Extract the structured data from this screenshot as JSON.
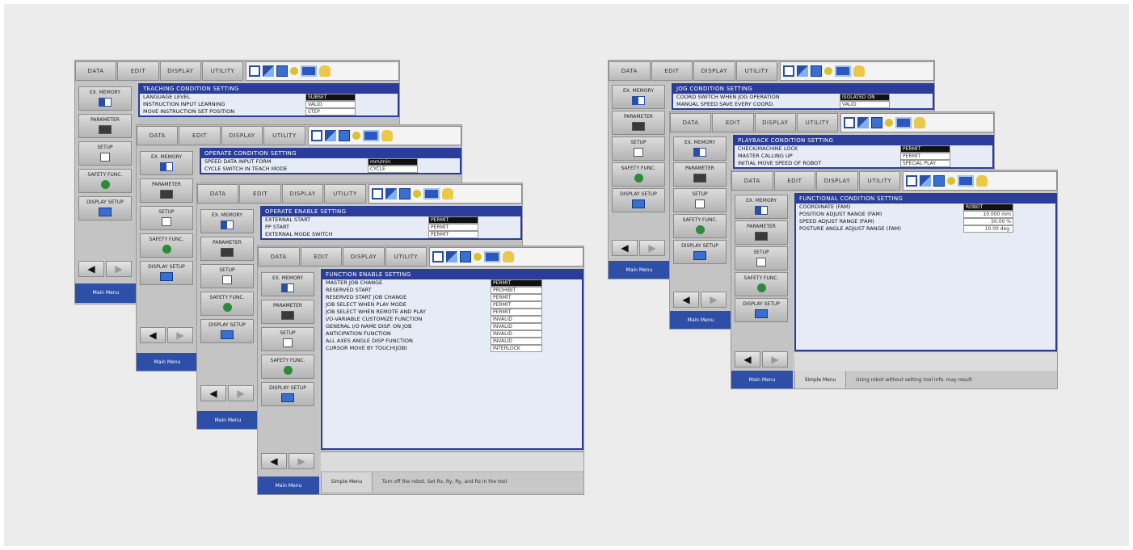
{
  "tabs": [
    "DATA",
    "EDIT",
    "DISPLAY",
    "UTILITY"
  ],
  "sidebar": {
    "ex_memory": "EX. MEMORY",
    "parameter": "PARAMETER",
    "setup": "SETUP",
    "safety": "SAFETY FUNC.",
    "display_setup": "DISPLAY SETUP",
    "main_menu": "Main Menu",
    "simple_menu": "Simple Menu"
  },
  "left_group": {
    "teaching": {
      "title": "TEACHING CONDITION SETTING",
      "rows": [
        {
          "label": "LANGUAGE LEVEL",
          "value": "SUBSET"
        },
        {
          "label": "INSTRUCTION INPUT LEARNING",
          "value": "VALID"
        },
        {
          "label": "MOVE INSTRUCTION SET POSITION",
          "value": "STEP"
        }
      ]
    },
    "operate": {
      "title": "OPERATE CONDITION SETTING",
      "rows": [
        {
          "label": "SPEED DATA INPUT FORM",
          "value": "mm/min"
        },
        {
          "label": "CYCLE SWITCH IN TEACH MODE",
          "value": "CYCLE"
        }
      ]
    },
    "operate_enable": {
      "title": "OPERATE ENABLE SETTING",
      "rows": [
        {
          "label": "EXTERNAL START",
          "value": "PERMIT"
        },
        {
          "label": "PP START",
          "value": "PERMIT"
        },
        {
          "label": "EXTERNAL MODE SWITCH",
          "value": "PERMIT"
        }
      ]
    },
    "function_enable": {
      "title": "FUNCTION ENABLE SETTING",
      "rows": [
        {
          "label": "MASTER JOB CHANGE",
          "value": "PERMIT"
        },
        {
          "label": "RESERVED START",
          "value": "PROHIBIT"
        },
        {
          "label": "RESERVED START JOB CHANGE",
          "value": "PERMIT"
        },
        {
          "label": "JOB SELECT WHEN PLAY MODE",
          "value": "PERMIT"
        },
        {
          "label": "JOB SELECT WHEN REMOTE AND PLAY",
          "value": "PERMIT"
        },
        {
          "label": "I/O-VARIABLE CUSTOMIZE FUNCTION",
          "value": "INVALID"
        },
        {
          "label": "GENERAL I/O NAME DISP. ON JOB",
          "value": "INVALID"
        },
        {
          "label": "ANTICIPATION FUNCTION",
          "value": "INVALID"
        },
        {
          "label": "ALL AXES ANGLE DISP FUNCTION",
          "value": "INVALID"
        },
        {
          "label": "CURSOR MOVE BY TOUCH(JOB)",
          "value": "INTERLOCK"
        }
      ],
      "message": "Turn off the robot. Set Rx, Ry, Ry, and Rz in the tool"
    }
  },
  "right_group": {
    "jog": {
      "title": "JOG CONDITION SETTING",
      "rows": [
        {
          "label": "COORD SWITCH WHEN JOG OPERATION",
          "value": "ISOLATED ON"
        },
        {
          "label": "MANUAL SPEED SAVE EVERY COORD.",
          "value": "VALID"
        }
      ]
    },
    "playback": {
      "title": "PLAYBACK CONDITION SETTING",
      "rows": [
        {
          "label": "CHECK/MACHINE LOCK",
          "value": "PERMIT"
        },
        {
          "label": "MASTER CALLING UP",
          "value": "PERMIT"
        },
        {
          "label": "INITIAL MOVE SPEED OF ROBOT",
          "value": "SPECIAL PLAY"
        }
      ]
    },
    "functional": {
      "title": "FUNCTIONAL CONDITION SETTING",
      "rows": [
        {
          "label": "COORDINATE (FAM)",
          "value": "ROBOT"
        },
        {
          "label": "POSITION ADJUST RANGE (FAM)",
          "value": "10.000 mm"
        },
        {
          "label": "SPEED ADJUST RANGE (FAM)",
          "value": "50.00 %"
        },
        {
          "label": "POSTURE ANGLE ADJUST RANGE (FAM)",
          "value": "10.00 deg."
        }
      ],
      "message": "Using robot without setting tool info. may result"
    }
  }
}
